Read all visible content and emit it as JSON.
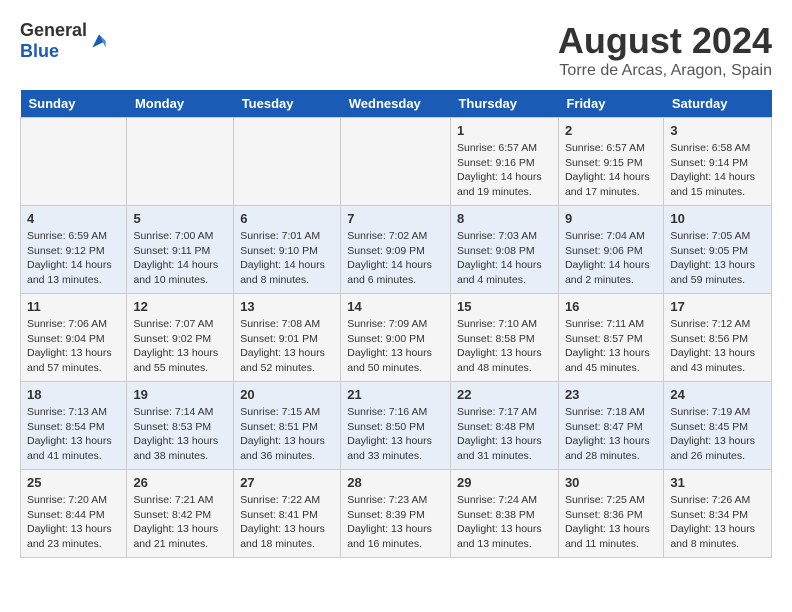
{
  "header": {
    "logo_general": "General",
    "logo_blue": "Blue",
    "month_title": "August 2024",
    "location": "Torre de Arcas, Aragon, Spain"
  },
  "weekdays": [
    "Sunday",
    "Monday",
    "Tuesday",
    "Wednesday",
    "Thursday",
    "Friday",
    "Saturday"
  ],
  "weeks": [
    [
      {
        "day": "",
        "info": ""
      },
      {
        "day": "",
        "info": ""
      },
      {
        "day": "",
        "info": ""
      },
      {
        "day": "",
        "info": ""
      },
      {
        "day": "1",
        "info": "Sunrise: 6:57 AM\nSunset: 9:16 PM\nDaylight: 14 hours\nand 19 minutes."
      },
      {
        "day": "2",
        "info": "Sunrise: 6:57 AM\nSunset: 9:15 PM\nDaylight: 14 hours\nand 17 minutes."
      },
      {
        "day": "3",
        "info": "Sunrise: 6:58 AM\nSunset: 9:14 PM\nDaylight: 14 hours\nand 15 minutes."
      }
    ],
    [
      {
        "day": "4",
        "info": "Sunrise: 6:59 AM\nSunset: 9:12 PM\nDaylight: 14 hours\nand 13 minutes."
      },
      {
        "day": "5",
        "info": "Sunrise: 7:00 AM\nSunset: 9:11 PM\nDaylight: 14 hours\nand 10 minutes."
      },
      {
        "day": "6",
        "info": "Sunrise: 7:01 AM\nSunset: 9:10 PM\nDaylight: 14 hours\nand 8 minutes."
      },
      {
        "day": "7",
        "info": "Sunrise: 7:02 AM\nSunset: 9:09 PM\nDaylight: 14 hours\nand 6 minutes."
      },
      {
        "day": "8",
        "info": "Sunrise: 7:03 AM\nSunset: 9:08 PM\nDaylight: 14 hours\nand 4 minutes."
      },
      {
        "day": "9",
        "info": "Sunrise: 7:04 AM\nSunset: 9:06 PM\nDaylight: 14 hours\nand 2 minutes."
      },
      {
        "day": "10",
        "info": "Sunrise: 7:05 AM\nSunset: 9:05 PM\nDaylight: 13 hours\nand 59 minutes."
      }
    ],
    [
      {
        "day": "11",
        "info": "Sunrise: 7:06 AM\nSunset: 9:04 PM\nDaylight: 13 hours\nand 57 minutes."
      },
      {
        "day": "12",
        "info": "Sunrise: 7:07 AM\nSunset: 9:02 PM\nDaylight: 13 hours\nand 55 minutes."
      },
      {
        "day": "13",
        "info": "Sunrise: 7:08 AM\nSunset: 9:01 PM\nDaylight: 13 hours\nand 52 minutes."
      },
      {
        "day": "14",
        "info": "Sunrise: 7:09 AM\nSunset: 9:00 PM\nDaylight: 13 hours\nand 50 minutes."
      },
      {
        "day": "15",
        "info": "Sunrise: 7:10 AM\nSunset: 8:58 PM\nDaylight: 13 hours\nand 48 minutes."
      },
      {
        "day": "16",
        "info": "Sunrise: 7:11 AM\nSunset: 8:57 PM\nDaylight: 13 hours\nand 45 minutes."
      },
      {
        "day": "17",
        "info": "Sunrise: 7:12 AM\nSunset: 8:56 PM\nDaylight: 13 hours\nand 43 minutes."
      }
    ],
    [
      {
        "day": "18",
        "info": "Sunrise: 7:13 AM\nSunset: 8:54 PM\nDaylight: 13 hours\nand 41 minutes."
      },
      {
        "day": "19",
        "info": "Sunrise: 7:14 AM\nSunset: 8:53 PM\nDaylight: 13 hours\nand 38 minutes."
      },
      {
        "day": "20",
        "info": "Sunrise: 7:15 AM\nSunset: 8:51 PM\nDaylight: 13 hours\nand 36 minutes."
      },
      {
        "day": "21",
        "info": "Sunrise: 7:16 AM\nSunset: 8:50 PM\nDaylight: 13 hours\nand 33 minutes."
      },
      {
        "day": "22",
        "info": "Sunrise: 7:17 AM\nSunset: 8:48 PM\nDaylight: 13 hours\nand 31 minutes."
      },
      {
        "day": "23",
        "info": "Sunrise: 7:18 AM\nSunset: 8:47 PM\nDaylight: 13 hours\nand 28 minutes."
      },
      {
        "day": "24",
        "info": "Sunrise: 7:19 AM\nSunset: 8:45 PM\nDaylight: 13 hours\nand 26 minutes."
      }
    ],
    [
      {
        "day": "25",
        "info": "Sunrise: 7:20 AM\nSunset: 8:44 PM\nDaylight: 13 hours\nand 23 minutes."
      },
      {
        "day": "26",
        "info": "Sunrise: 7:21 AM\nSunset: 8:42 PM\nDaylight: 13 hours\nand 21 minutes."
      },
      {
        "day": "27",
        "info": "Sunrise: 7:22 AM\nSunset: 8:41 PM\nDaylight: 13 hours\nand 18 minutes."
      },
      {
        "day": "28",
        "info": "Sunrise: 7:23 AM\nSunset: 8:39 PM\nDaylight: 13 hours\nand 16 minutes."
      },
      {
        "day": "29",
        "info": "Sunrise: 7:24 AM\nSunset: 8:38 PM\nDaylight: 13 hours\nand 13 minutes."
      },
      {
        "day": "30",
        "info": "Sunrise: 7:25 AM\nSunset: 8:36 PM\nDaylight: 13 hours\nand 11 minutes."
      },
      {
        "day": "31",
        "info": "Sunrise: 7:26 AM\nSunset: 8:34 PM\nDaylight: 13 hours\nand 8 minutes."
      }
    ]
  ]
}
